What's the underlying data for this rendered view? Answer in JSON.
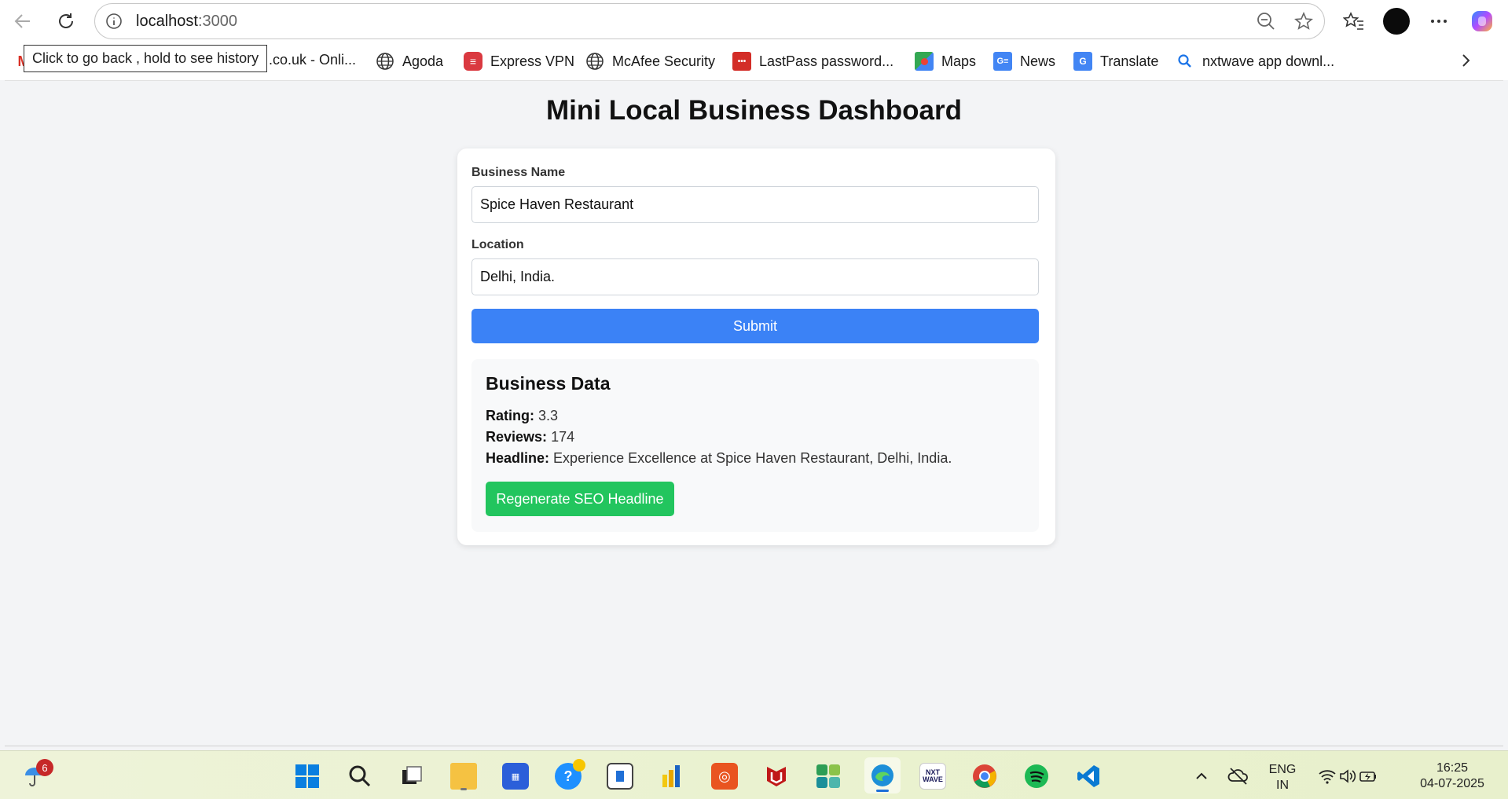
{
  "browser": {
    "url_host": "localhost",
    "url_port": ":3000",
    "tooltip": "Click to go back , hold to see history",
    "bookmarks": [
      {
        "label": ".co.uk - Onli..."
      },
      {
        "label": "Agoda"
      },
      {
        "label": "Express VPN"
      },
      {
        "label": "McAfee Security"
      },
      {
        "label": "LastPass password..."
      },
      {
        "label": "Maps"
      },
      {
        "label": "News"
      },
      {
        "label": "Translate"
      },
      {
        "label": "nxtwave app downl..."
      }
    ]
  },
  "page": {
    "title": "Mini Local Business Dashboard",
    "form": {
      "business_name_label": "Business Name",
      "business_name_value": "Spice Haven Restaurant",
      "location_label": "Location",
      "location_value": "Delhi, India.",
      "submit_label": "Submit"
    },
    "business_data": {
      "heading": "Business Data",
      "rating_label": "Rating:",
      "rating_value": "3.3",
      "reviews_label": "Reviews:",
      "reviews_value": "174",
      "headline_label": "Headline:",
      "headline_value": "Experience Excellence at Spice Haven Restaurant, Delhi, India.",
      "regenerate_label": "Regenerate SEO Headline"
    }
  },
  "taskbar": {
    "weather_badge": "6",
    "language_line1": "ENG",
    "language_line2": "IN",
    "time": "16:25",
    "date": "04-07-2025",
    "icons": [
      "start-icon",
      "search-icon",
      "task-view-icon",
      "file-explorer-icon",
      "microsoft-store-icon",
      "help-icon",
      "app-window-icon",
      "power-bi-icon",
      "ubuntu-icon",
      "mcafee-icon",
      "app-grid-icon",
      "edge-icon",
      "nxtwave-icon",
      "chrome-icon",
      "spotify-icon",
      "vscode-icon"
    ]
  },
  "colors": {
    "submit": "#3b82f6",
    "regenerate": "#22c55e",
    "background": "#f3f4f6"
  }
}
